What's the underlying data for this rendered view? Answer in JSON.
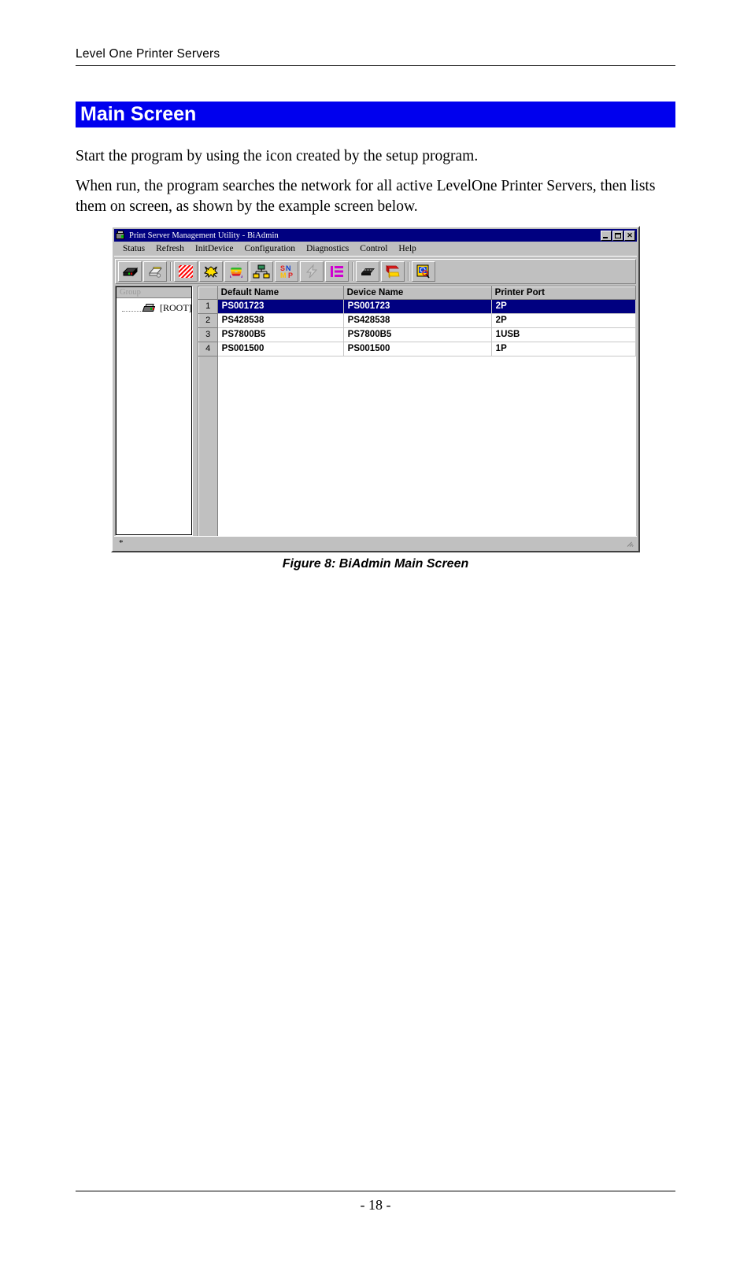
{
  "document": {
    "running_header": "Level One Printer Servers",
    "section_heading": "Main Screen",
    "paragraph_1": "Start the program by using the icon created by the setup program.",
    "paragraph_2": "When run, the program searches the network for all active LevelOne Printer Servers, then lists them on screen, as shown by the example screen below.",
    "figure_caption": "Figure 8: BiAdmin Main Screen",
    "page_number": "- 18 -",
    "heading_band_color": "#0000EE"
  },
  "app": {
    "title": "Print Server Management Utility - BiAdmin",
    "titlebar_color": "#000080",
    "window_buttons": [
      {
        "name": "minimize-button",
        "label": ""
      },
      {
        "name": "maximize-button",
        "label": ""
      },
      {
        "name": "close-button",
        "label": "✕"
      }
    ],
    "menu": [
      "Status",
      "Refresh",
      "InitDevice",
      "Configuration",
      "Diagnostics",
      "Control",
      "Help"
    ],
    "toolbar": [
      {
        "name": "print-server-icon",
        "title": "Print Server"
      },
      {
        "name": "printer-icon",
        "title": "Printer"
      },
      {
        "name": "netware-icon",
        "title": "NetWare"
      },
      {
        "name": "netbeui-icon",
        "title": "NetBEUI"
      },
      {
        "name": "appletalk-icon",
        "title": "AppleTalk"
      },
      {
        "name": "tcpip-icon",
        "title": "TCP/IP"
      },
      {
        "name": "snmp-icon",
        "title": "SNMP"
      },
      {
        "name": "internet-printing-icon",
        "title": "Internet Printing"
      },
      {
        "name": "logical-port-icon",
        "title": "Logical Port"
      },
      {
        "name": "firmware-chip-icon",
        "title": "Upgrade Firmware"
      },
      {
        "name": "import-export-icon",
        "title": "Import / Export"
      },
      {
        "name": "web-admin-icon",
        "title": "Web Administration"
      }
    ],
    "tree": {
      "header": "Group",
      "root_label": "[ROOT]",
      "root_icon": "print-server-icon"
    },
    "grid": {
      "columns": [
        "",
        "Default Name",
        "Device Name",
        "Printer Port"
      ],
      "rows": [
        {
          "num": "1",
          "default_name": "PS001723",
          "device_name": "PS001723",
          "printer_port": "2P",
          "selected": true
        },
        {
          "num": "2",
          "default_name": "PS428538",
          "device_name": "PS428538",
          "printer_port": "2P",
          "selected": false
        },
        {
          "num": "3",
          "default_name": "PS7800B5",
          "device_name": "PS7800B5",
          "printer_port": "1USB",
          "selected": false
        },
        {
          "num": "4",
          "default_name": "PS001500",
          "device_name": "PS001500",
          "printer_port": "1P",
          "selected": false
        }
      ],
      "selection_color": "#000080"
    },
    "statusbar": {
      "text": "*"
    }
  }
}
